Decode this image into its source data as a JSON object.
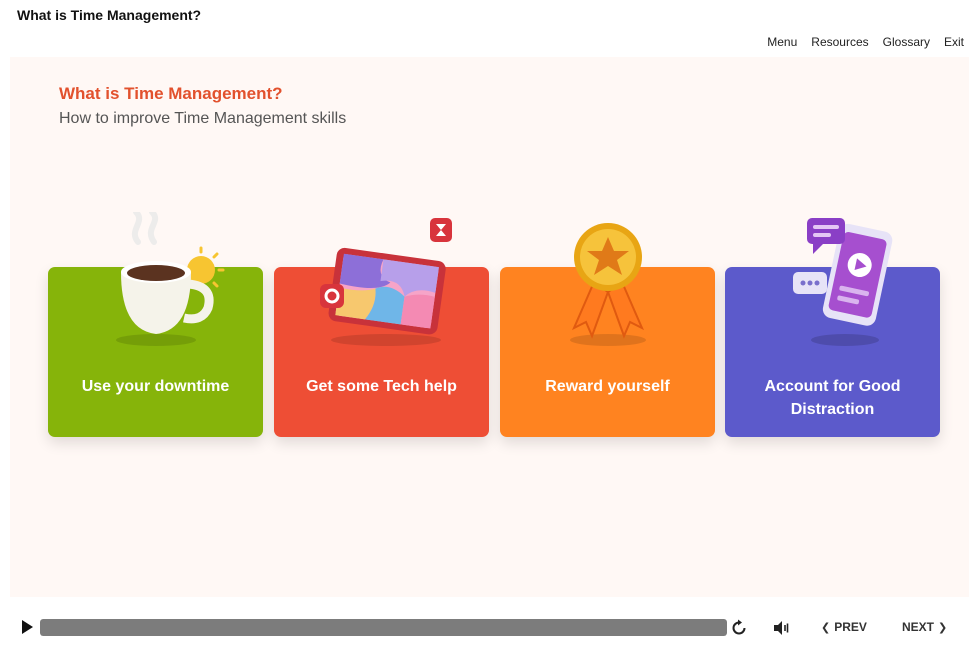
{
  "window": {
    "title": "What is Time Management?"
  },
  "nav": {
    "menu": "Menu",
    "resources": "Resources",
    "glossary": "Glossary",
    "exit": "Exit"
  },
  "slide": {
    "title": "What is Time Management?",
    "subtitle": "How to improve Time Management skills",
    "cards": [
      {
        "label": "Use your downtime",
        "color": "#86b40a",
        "icon": "coffee-cup-icon"
      },
      {
        "label": "Get some Tech help",
        "color": "#ee4e35",
        "icon": "tablet-puzzle-icon"
      },
      {
        "label": "Reward yourself",
        "color": "#ff8320",
        "icon": "medal-icon"
      },
      {
        "label": "Account for Good Distraction",
        "color": "#5c5acb",
        "icon": "phone-chat-icon"
      }
    ]
  },
  "player": {
    "progress": 1.0,
    "prev_label": "PREV",
    "next_label": "NEXT",
    "prev_chevron": "❮",
    "next_chevron": "❯"
  }
}
